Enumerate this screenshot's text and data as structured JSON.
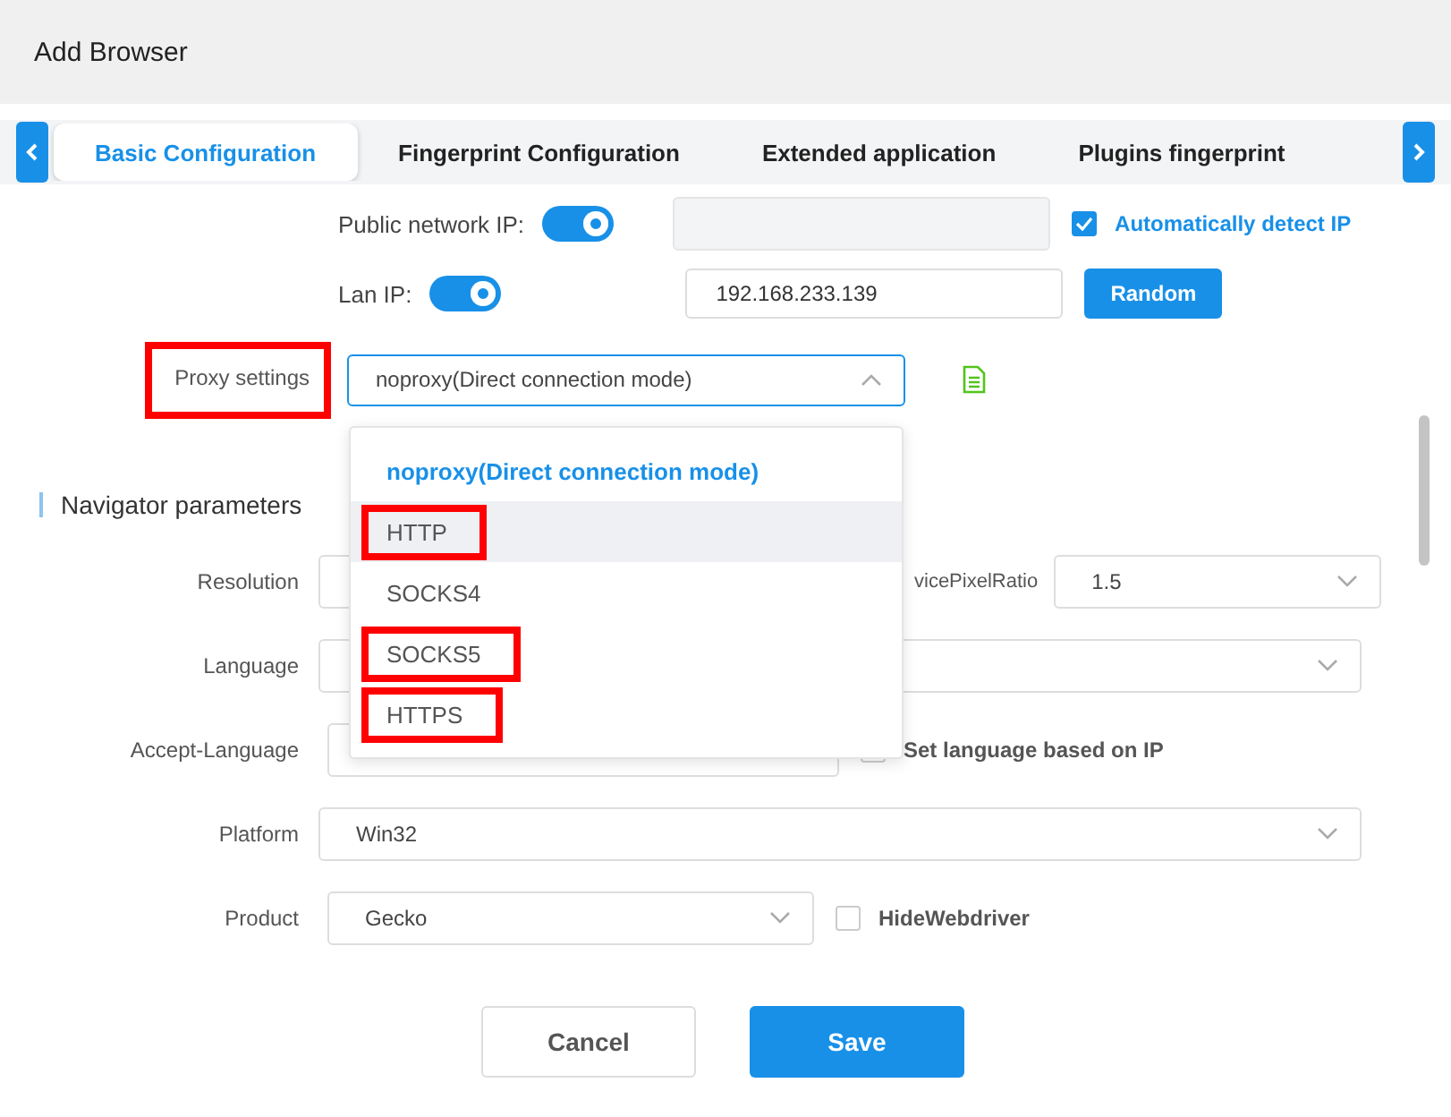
{
  "window": {
    "title": "Add Browser"
  },
  "tabs": [
    {
      "label": "Basic Configuration",
      "selected": true
    },
    {
      "label": "Fingerprint Configuration",
      "selected": false
    },
    {
      "label": "Extended application",
      "selected": false
    },
    {
      "label": "Plugins fingerprint",
      "selected": false
    }
  ],
  "public_ip": {
    "label": "Public network IP:",
    "on": true,
    "auto_detect": {
      "label": "Automatically detect IP",
      "checked": true
    }
  },
  "lan_ip": {
    "label": "Lan IP:",
    "on": true,
    "value": "192.168.233.139",
    "button": "Random"
  },
  "proxy": {
    "label": "Proxy settings",
    "highlighted": true,
    "value": "noproxy(Direct connection mode)",
    "expanded": true,
    "options": [
      {
        "label": "noproxy(Direct connection mode)",
        "selected": true,
        "hovered": false,
        "highlighted": false
      },
      {
        "label": "HTTP",
        "selected": false,
        "hovered": true,
        "highlighted": true
      },
      {
        "label": "SOCKS4",
        "selected": false,
        "hovered": false,
        "highlighted": false
      },
      {
        "label": "SOCKS5",
        "selected": false,
        "hovered": false,
        "highlighted": true
      },
      {
        "label": "HTTPS",
        "selected": false,
        "hovered": false,
        "highlighted": true
      }
    ]
  },
  "navigator": {
    "title": "Navigator parameters",
    "resolution": {
      "label": "Resolution",
      "ratio_label": "vicePixelRatio",
      "ratio_value": "1.5"
    },
    "language": {
      "label": "Language"
    },
    "accept_language": {
      "label": "Accept-Language",
      "by_ip": {
        "label": "Set language based on IP",
        "checked": false
      }
    },
    "platform": {
      "label": "Platform",
      "value": "Win32"
    },
    "product": {
      "label": "Product",
      "value": "Gecko",
      "hide_webdriver": {
        "label": "HideWebdriver",
        "checked": false
      }
    }
  },
  "buttons": {
    "cancel": "Cancel",
    "save": "Save"
  }
}
